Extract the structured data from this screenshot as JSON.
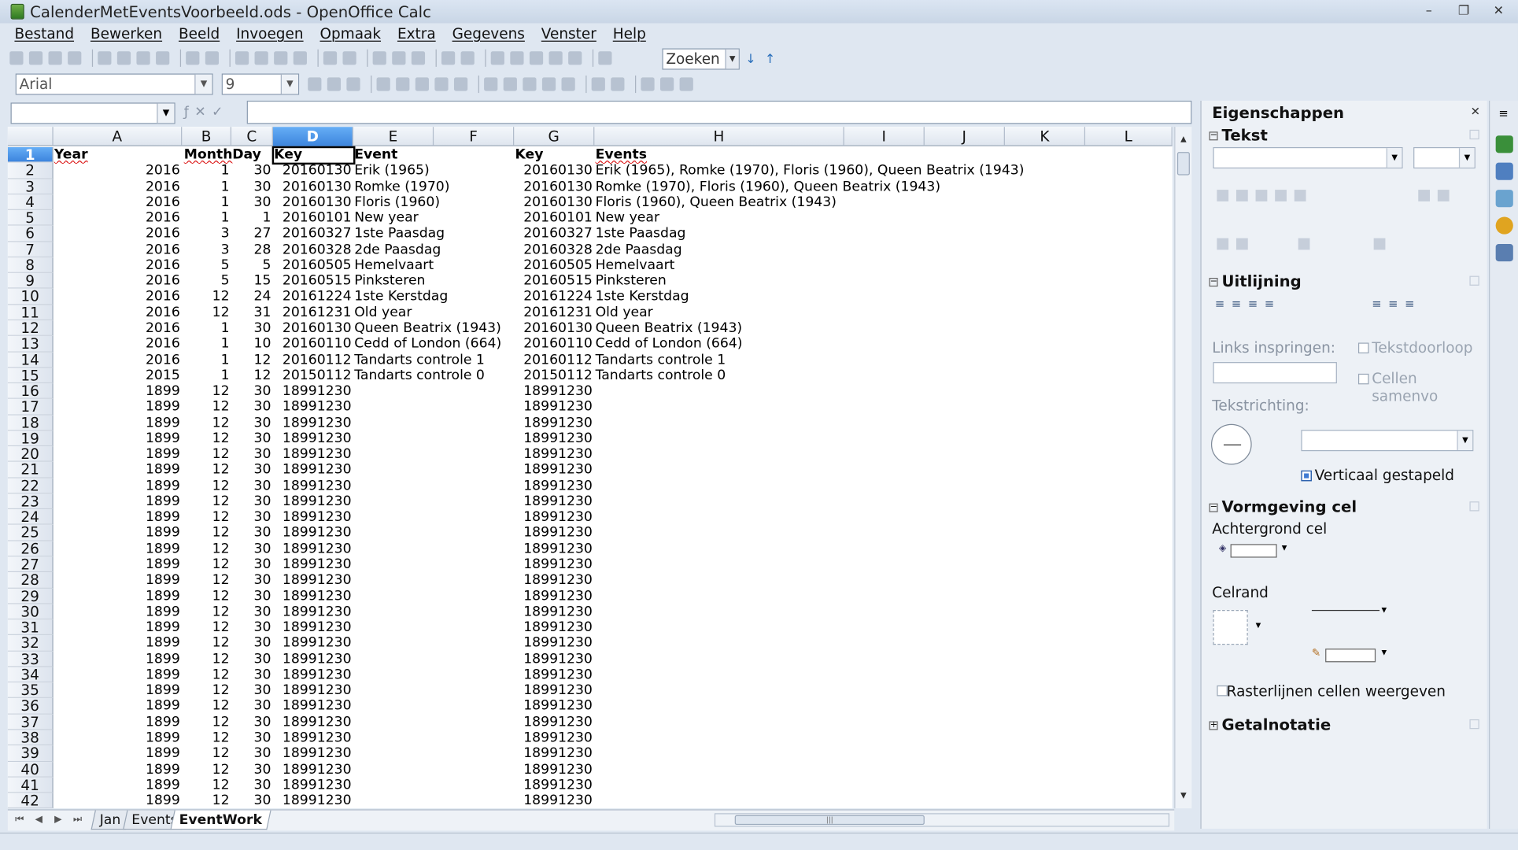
{
  "window": {
    "title": "CalenderMetEventsVoorbeeld.ods - OpenOffice Calc",
    "minimize": "–",
    "restore": "❐",
    "close": "✕"
  },
  "menu": [
    "Bestand",
    "Bewerken",
    "Beeld",
    "Invoegen",
    "Opmaak",
    "Extra",
    "Gegevens",
    "Venster",
    "Help"
  ],
  "toolbar": {
    "search_value": "Zoeken",
    "font_name": "Arial",
    "font_size": "9",
    "dropdown_glyph": "▼"
  },
  "namebox": {
    "value": ""
  },
  "formula_bar": {
    "value": ""
  },
  "columns": [
    "A",
    "B",
    "C",
    "D",
    "E",
    "F",
    "G",
    "H",
    "I",
    "J",
    "K",
    "L"
  ],
  "selected_column": "D",
  "selected_row": "1",
  "header_row": {
    "row": "1",
    "cells": [
      "Year",
      "Month",
      "Day",
      "Key",
      "Event",
      "Key",
      "Events"
    ]
  },
  "rows": [
    {
      "row": "2",
      "year": "2016",
      "month": "1",
      "day": "30",
      "key": "20160130",
      "event": "Erik (1965)",
      "key2": "20160130",
      "events": "Erik (1965), Romke (1970), Floris (1960), Queen Beatrix (1943)"
    },
    {
      "row": "3",
      "year": "2016",
      "month": "1",
      "day": "30",
      "key": "20160130",
      "event": "Romke (1970)",
      "key2": "20160130",
      "events": "Romke (1970), Floris (1960), Queen Beatrix (1943)"
    },
    {
      "row": "4",
      "year": "2016",
      "month": "1",
      "day": "30",
      "key": "20160130",
      "event": "Floris (1960)",
      "key2": "20160130",
      "events": "Floris (1960), Queen Beatrix (1943)"
    },
    {
      "row": "5",
      "year": "2016",
      "month": "1",
      "day": "1",
      "key": "20160101",
      "event": "New year",
      "key2": "20160101",
      "events": "New year"
    },
    {
      "row": "6",
      "year": "2016",
      "month": "3",
      "day": "27",
      "key": "20160327",
      "event": "1ste Paasdag",
      "key2": "20160327",
      "events": "1ste Paasdag"
    },
    {
      "row": "7",
      "year": "2016",
      "month": "3",
      "day": "28",
      "key": "20160328",
      "event": "2de Paasdag",
      "key2": "20160328",
      "events": "2de Paasdag"
    },
    {
      "row": "8",
      "year": "2016",
      "month": "5",
      "day": "5",
      "key": "20160505",
      "event": "Hemelvaart",
      "key2": "20160505",
      "events": "Hemelvaart"
    },
    {
      "row": "9",
      "year": "2016",
      "month": "5",
      "day": "15",
      "key": "20160515",
      "event": "Pinksteren",
      "key2": "20160515",
      "events": "Pinksteren"
    },
    {
      "row": "10",
      "year": "2016",
      "month": "12",
      "day": "24",
      "key": "20161224",
      "event": "1ste Kerstdag",
      "key2": "20161224",
      "events": "1ste Kerstdag"
    },
    {
      "row": "11",
      "year": "2016",
      "month": "12",
      "day": "31",
      "key": "20161231",
      "event": "Old year",
      "key2": "20161231",
      "events": "Old year"
    },
    {
      "row": "12",
      "year": "2016",
      "month": "1",
      "day": "30",
      "key": "20160130",
      "event": "Queen Beatrix (1943)",
      "key2": "20160130",
      "events": "Queen Beatrix (1943)"
    },
    {
      "row": "13",
      "year": "2016",
      "month": "1",
      "day": "10",
      "key": "20160110",
      "event": "Cedd of London (664)",
      "key2": "20160110",
      "events": "Cedd of London (664)"
    },
    {
      "row": "14",
      "year": "2016",
      "month": "1",
      "day": "12",
      "key": "20160112",
      "event": "Tandarts controle 1",
      "key2": "20160112",
      "events": "Tandarts controle 1"
    },
    {
      "row": "15",
      "year": "2015",
      "month": "1",
      "day": "12",
      "key": "20150112",
      "event": "Tandarts controle 0",
      "key2": "20150112",
      "events": "Tandarts controle 0"
    },
    {
      "row": "16",
      "year": "1899",
      "month": "12",
      "day": "30",
      "key": "18991230",
      "event": "",
      "key2": "18991230",
      "events": ""
    },
    {
      "row": "17",
      "year": "1899",
      "month": "12",
      "day": "30",
      "key": "18991230",
      "event": "",
      "key2": "18991230",
      "events": ""
    },
    {
      "row": "18",
      "year": "1899",
      "month": "12",
      "day": "30",
      "key": "18991230",
      "event": "",
      "key2": "18991230",
      "events": ""
    },
    {
      "row": "19",
      "year": "1899",
      "month": "12",
      "day": "30",
      "key": "18991230",
      "event": "",
      "key2": "18991230",
      "events": ""
    },
    {
      "row": "20",
      "year": "1899",
      "month": "12",
      "day": "30",
      "key": "18991230",
      "event": "",
      "key2": "18991230",
      "events": ""
    },
    {
      "row": "21",
      "year": "1899",
      "month": "12",
      "day": "30",
      "key": "18991230",
      "event": "",
      "key2": "18991230",
      "events": ""
    },
    {
      "row": "22",
      "year": "1899",
      "month": "12",
      "day": "30",
      "key": "18991230",
      "event": "",
      "key2": "18991230",
      "events": ""
    },
    {
      "row": "23",
      "year": "1899",
      "month": "12",
      "day": "30",
      "key": "18991230",
      "event": "",
      "key2": "18991230",
      "events": ""
    },
    {
      "row": "24",
      "year": "1899",
      "month": "12",
      "day": "30",
      "key": "18991230",
      "event": "",
      "key2": "18991230",
      "events": ""
    },
    {
      "row": "25",
      "year": "1899",
      "month": "12",
      "day": "30",
      "key": "18991230",
      "event": "",
      "key2": "18991230",
      "events": ""
    },
    {
      "row": "26",
      "year": "1899",
      "month": "12",
      "day": "30",
      "key": "18991230",
      "event": "",
      "key2": "18991230",
      "events": ""
    },
    {
      "row": "27",
      "year": "1899",
      "month": "12",
      "day": "30",
      "key": "18991230",
      "event": "",
      "key2": "18991230",
      "events": ""
    },
    {
      "row": "28",
      "year": "1899",
      "month": "12",
      "day": "30",
      "key": "18991230",
      "event": "",
      "key2": "18991230",
      "events": ""
    },
    {
      "row": "29",
      "year": "1899",
      "month": "12",
      "day": "30",
      "key": "18991230",
      "event": "",
      "key2": "18991230",
      "events": ""
    },
    {
      "row": "30",
      "year": "1899",
      "month": "12",
      "day": "30",
      "key": "18991230",
      "event": "",
      "key2": "18991230",
      "events": ""
    },
    {
      "row": "31",
      "year": "1899",
      "month": "12",
      "day": "30",
      "key": "18991230",
      "event": "",
      "key2": "18991230",
      "events": ""
    },
    {
      "row": "32",
      "year": "1899",
      "month": "12",
      "day": "30",
      "key": "18991230",
      "event": "",
      "key2": "18991230",
      "events": ""
    },
    {
      "row": "33",
      "year": "1899",
      "month": "12",
      "day": "30",
      "key": "18991230",
      "event": "",
      "key2": "18991230",
      "events": ""
    },
    {
      "row": "34",
      "year": "1899",
      "month": "12",
      "day": "30",
      "key": "18991230",
      "event": "",
      "key2": "18991230",
      "events": ""
    },
    {
      "row": "35",
      "year": "1899",
      "month": "12",
      "day": "30",
      "key": "18991230",
      "event": "",
      "key2": "18991230",
      "events": ""
    },
    {
      "row": "36",
      "year": "1899",
      "month": "12",
      "day": "30",
      "key": "18991230",
      "event": "",
      "key2": "18991230",
      "events": ""
    },
    {
      "row": "37",
      "year": "1899",
      "month": "12",
      "day": "30",
      "key": "18991230",
      "event": "",
      "key2": "18991230",
      "events": ""
    },
    {
      "row": "38",
      "year": "1899",
      "month": "12",
      "day": "30",
      "key": "18991230",
      "event": "",
      "key2": "18991230",
      "events": ""
    },
    {
      "row": "39",
      "year": "1899",
      "month": "12",
      "day": "30",
      "key": "18991230",
      "event": "",
      "key2": "18991230",
      "events": ""
    },
    {
      "row": "40",
      "year": "1899",
      "month": "12",
      "day": "30",
      "key": "18991230",
      "event": "",
      "key2": "18991230",
      "events": ""
    },
    {
      "row": "41",
      "year": "1899",
      "month": "12",
      "day": "30",
      "key": "18991230",
      "event": "",
      "key2": "18991230",
      "events": ""
    },
    {
      "row": "42",
      "year": "1899",
      "month": "12",
      "day": "30",
      "key": "18991230",
      "event": "",
      "key2": "18991230",
      "events": ""
    }
  ],
  "sheet_tabs": [
    "Jan",
    "Events",
    "EventWork"
  ],
  "active_sheet": "EventWork",
  "sidebar": {
    "title": "Eigenschappen",
    "close": "✕",
    "section_tekst": "Tekst",
    "section_uitlijning": "Uitlijning",
    "links_inspringen": "Links inspringen:",
    "tekstdoorloop": "Tekstdoorloop",
    "cellen_samenvoegen": "Cellen samenvo",
    "tekstrichting": "Tekstrichting:",
    "verticaal_gestapeld": "Verticaal gestapeld",
    "verticaal_gestapeld_checked": true,
    "section_vormgeving": "Vormgeving cel",
    "achtergrond_cel": "Achtergrond cel",
    "celrand": "Celrand",
    "rasterlijnen": "Rasterlijnen cellen weergeven",
    "section_getalnotatie": "Getalnotatie",
    "collapse_glyph": "−",
    "expand_glyph": "+"
  },
  "colors": {
    "selection_header": "#3c84dd",
    "app_icon": "#2f7a22"
  }
}
